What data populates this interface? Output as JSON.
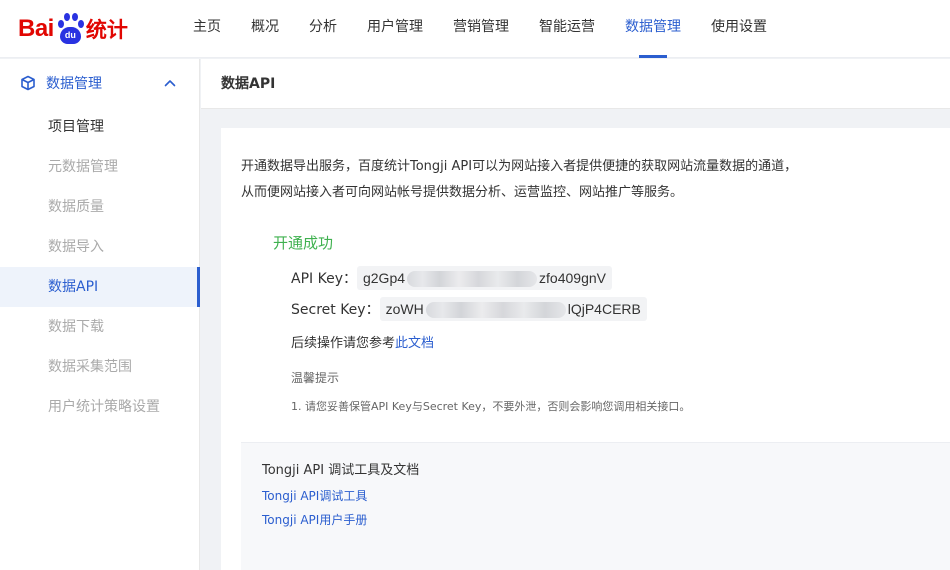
{
  "logo": {
    "bai": "Bai",
    "du": "du",
    "tongji": "统计"
  },
  "nav": {
    "items": [
      {
        "label": "主页"
      },
      {
        "label": "概况"
      },
      {
        "label": "分析"
      },
      {
        "label": "用户管理"
      },
      {
        "label": "营销管理"
      },
      {
        "label": "智能运营"
      },
      {
        "label": "数据管理"
      },
      {
        "label": "使用设置"
      }
    ],
    "active": "数据管理"
  },
  "sidebar": {
    "section_title": "数据管理",
    "items": [
      {
        "label": "项目管理"
      },
      {
        "label": "元数据管理"
      },
      {
        "label": "数据质量"
      },
      {
        "label": "数据导入"
      },
      {
        "label": "数据API"
      },
      {
        "label": "数据下载"
      },
      {
        "label": "数据采集范围"
      },
      {
        "label": "用户统计策略设置"
      }
    ],
    "active": "数据API"
  },
  "content": {
    "header_title": "数据API",
    "intro_line1": "开通数据导出服务，百度统计Tongji API可以为网站接入者提供便捷的获取网站流量数据的通道，",
    "intro_line2": "从而便网站接入者可向网站帐号提供数据分析、运营监控、网站推广等服务。",
    "success_text": "开通成功",
    "api_key_label": "API Key：",
    "api_key_prefix": "g2Gp4",
    "api_key_suffix": "zfo409gnV",
    "secret_key_label": "Secret Key：",
    "secret_key_prefix": "zoWH",
    "secret_key_suffix": "lQjP4CERB",
    "follow_text": "后续操作请您参考",
    "follow_link": "此文档",
    "tips_title": "温馨提示",
    "tips_1": "1. 请您妥善保管API Key与Secret Key，不要外泄，否则会影响您调用相关接口。",
    "tools_title": "Tongji API 调试工具及文档",
    "tools_link1": "Tongji API调试工具",
    "tools_link2": "Tongji API用户手册"
  },
  "colors": {
    "accent": "#2b5ecf",
    "success": "#3fb14f",
    "brand_red": "#e10602",
    "brand_blue": "#2932e1"
  }
}
